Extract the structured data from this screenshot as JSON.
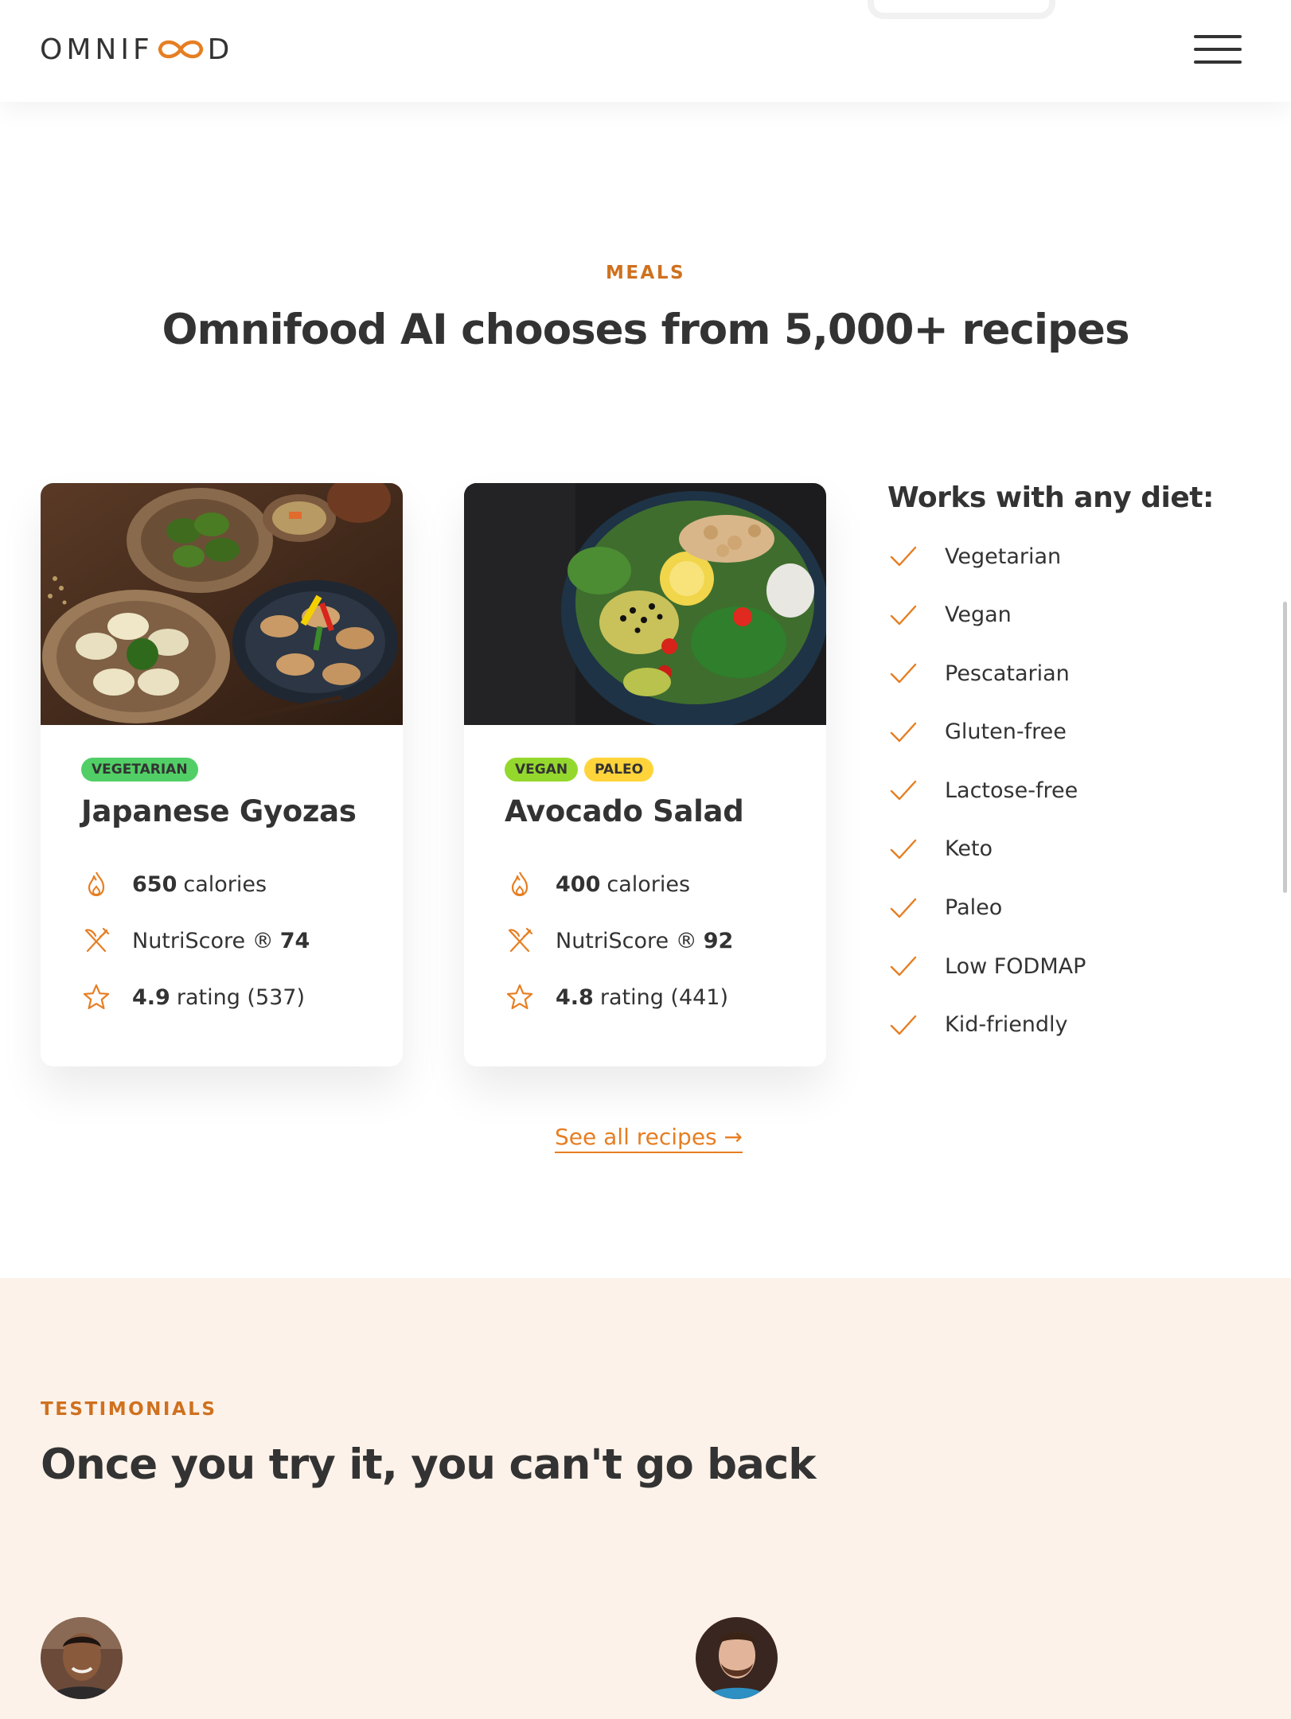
{
  "header": {
    "logo_text_left": "OMNIF",
    "logo_text_right": "D",
    "menu_icon": "hamburger-menu-icon",
    "brand_color": "#e67e22"
  },
  "meals": {
    "subheading": "MEALS",
    "title": "Omnifood AI chooses from 5,000+ recipes",
    "cards": [
      {
        "tags": [
          "VEGETARIAN"
        ],
        "name": "Japanese Gyozas",
        "calories_value": "650",
        "calories_label": "calories",
        "nutriscore_label": "NutriScore ®",
        "nutriscore_value": "74",
        "rating_value": "4.9",
        "rating_label": "rating (537)"
      },
      {
        "tags": [
          "VEGAN",
          "PALEO"
        ],
        "name": "Avocado Salad",
        "calories_value": "400",
        "calories_label": "calories",
        "nutriscore_label": "NutriScore ®",
        "nutriscore_value": "92",
        "rating_value": "4.8",
        "rating_label": "rating (441)"
      }
    ],
    "diets": {
      "title": "Works with any diet:",
      "items": [
        "Vegetarian",
        "Vegan",
        "Pescatarian",
        "Gluten-free",
        "Lactose-free",
        "Keto",
        "Paleo",
        "Low FODMAP",
        "Kid-friendly"
      ]
    },
    "see_all_link": "See all recipes →"
  },
  "testimonials": {
    "subheading": "TESTIMONIALS",
    "title": "Once you try it, you can't go back"
  },
  "colors": {
    "accent": "#e67e22",
    "accent_dark": "#cf711f",
    "text": "#333333",
    "testimonials_bg": "#fdf2e9",
    "tag_vegetarian": "#51cf66",
    "tag_vegan": "#94d82d",
    "tag_paleo": "#ffd43b"
  }
}
